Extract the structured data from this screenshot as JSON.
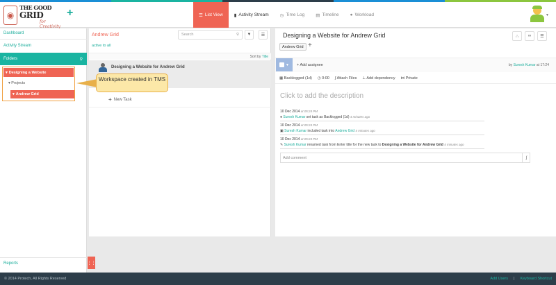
{
  "brand": {
    "line1": "THE",
    "line2": "GOOD",
    "line3": "GRID",
    "tagline": "for Creativity",
    "accent": "#ef6454",
    "teal": "#1ab4a1"
  },
  "nav": {
    "tabs": [
      {
        "label": "List View",
        "icon": "list-icon"
      },
      {
        "label": "Activity Stream",
        "icon": "comment-icon"
      },
      {
        "label": "Time Log",
        "icon": "clock-icon"
      },
      {
        "label": "Timeline",
        "icon": "bars-icon"
      },
      {
        "label": "Workload",
        "icon": "user-icon"
      }
    ]
  },
  "sidebar": {
    "dashboard": "Dashboard",
    "activity_stream": "Activity Stream",
    "folders": "Folders",
    "tree": {
      "root": "Designing a Website",
      "projects": "Projects",
      "child": "Andrew Grid"
    },
    "reports": "Reports"
  },
  "callout": {
    "text": "Workspace created in TMS"
  },
  "middle": {
    "title": "Andrew Grid",
    "filter_active": "active",
    "filter_sep": "to",
    "filter_all": "all",
    "search_placeholder": "Search",
    "sort_label": "Sort by",
    "sort_value": "Title",
    "task_title": "Designing a Website for Andrew Grid",
    "new_task": "New Task"
  },
  "detail": {
    "title": "Designing a Website for Andrew Grid",
    "tag": "Andrew Grid",
    "add_assignee": "Add assignee",
    "by_prefix": "by",
    "by_user": "Suresh Kumar",
    "by_time": "at 17:24",
    "meta": {
      "status": "Backlogged (1d)",
      "time": "0:00",
      "attach": "Attach Files",
      "dependency": "Add dependency",
      "private": "Private"
    },
    "description_placeholder": "Click to add the description",
    "activities": [
      {
        "date": "10 Dec 2014",
        "time": "at 05:24 PM",
        "user": "Suresh Kumar",
        "text": "set task as Backlogged (1d)",
        "link": "",
        "ago": "4 minutes ago"
      },
      {
        "date": "10 Dec 2014",
        "time": "at 05:24 PM",
        "user": "Suresh Kumar",
        "text": "included task into",
        "link": "Andrew Grid",
        "ago": "4 minutes ago"
      },
      {
        "date": "10 Dec 2014",
        "time": "at 05:24 PM",
        "user": "Suresh Kumar",
        "text": "renamed task from Enter title for the new task to",
        "link": "Designing a Website for Andrew Grid",
        "ago": "4 minutes ago"
      }
    ],
    "comment_placeholder": "Add comment"
  },
  "footer": {
    "copyright": "© 2014 Protech, All Rights Reserved",
    "add_users": "Add Users",
    "separator": "|",
    "shortcut": "Keyboard Shortcut"
  }
}
